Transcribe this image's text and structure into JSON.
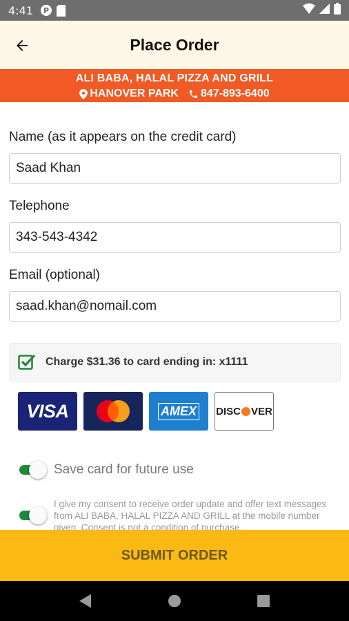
{
  "status_bar": {
    "time": "4:41"
  },
  "header": {
    "title": "Place Order"
  },
  "restaurant": {
    "name": "ALI BABA, HALAL PIZZA AND GRILL",
    "location": "HANOVER PARK",
    "phone": "847-893-6400"
  },
  "form": {
    "name_label": "Name (as it appears on the credit card)",
    "name_value": "Saad Khan",
    "phone_label": "Telephone",
    "phone_value": "343-543-4342",
    "email_label": "Email (optional)",
    "email_value": "saad.khan@nomail.com"
  },
  "payment": {
    "charge_text": "Charge $31.36 to card ending in: x1111",
    "charge_checked": true,
    "cards": [
      {
        "name": "visa",
        "label": "VISA"
      },
      {
        "name": "mastercard",
        "label": ""
      },
      {
        "name": "amex",
        "label": "AMEX"
      },
      {
        "name": "discover",
        "label_pre": "DISC",
        "label_post": "VER"
      }
    ]
  },
  "options": {
    "save_card_label": "Save card for future use",
    "save_card_on": true,
    "consent_text": "I give my consent to receive order update and offer text messages from ALI BABA, HALAL PIZZA AND GRILL at the mobile number given. Consent is not a condition of purchase.",
    "consent_on": true
  },
  "actions": {
    "submit_label": "SUBMIT ORDER"
  },
  "colors": {
    "banner": "#f15a24",
    "submit": "#fdb913",
    "toggle_on": "#1e8a3a",
    "checkbox": "#1e8a3a"
  },
  "icons": {
    "back": "arrow-left-icon",
    "location": "map-pin-icon",
    "phone": "phone-icon",
    "check": "checkbox-checked-icon"
  }
}
